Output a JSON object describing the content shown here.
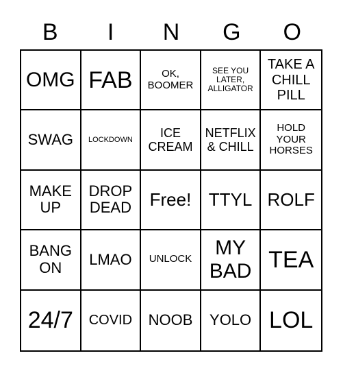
{
  "header": {
    "letters": [
      "B",
      "I",
      "N",
      "G",
      "O"
    ]
  },
  "board": {
    "cells": [
      "OMG",
      "FAB",
      "OK, BOOMER",
      "SEE YOU LATER, ALLIGATOR",
      "TAKE A CHILL PILL",
      "SWAG",
      "LOCKDOWN",
      "ICE CREAM",
      "NETFLIX & CHILL",
      "HOLD YOUR HORSES",
      "MAKE UP",
      "DROP DEAD",
      "Free!",
      "TTYL",
      "ROLF",
      "BANG ON",
      "LMAO",
      "UNLOCK",
      "MY BAD",
      "TEA",
      "24/7",
      "COVID",
      "NOOB",
      "YOLO",
      "LOL"
    ],
    "free_space_index": 12
  }
}
